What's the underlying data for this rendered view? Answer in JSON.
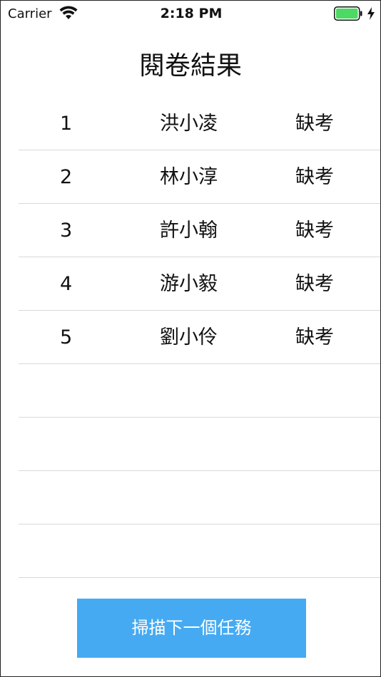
{
  "status_bar": {
    "carrier": "Carrier",
    "time": "2:18 PM",
    "battery_color": "#4cd964"
  },
  "title": "閱卷結果",
  "rows": [
    {
      "no": "1",
      "name": "洪小凌",
      "status": "缺考"
    },
    {
      "no": "2",
      "name": "林小淳",
      "status": "缺考"
    },
    {
      "no": "3",
      "name": "許小翰",
      "status": "缺考"
    },
    {
      "no": "4",
      "name": "游小毅",
      "status": "缺考"
    },
    {
      "no": "5",
      "name": "劉小伶",
      "status": "缺考"
    },
    {
      "no": "",
      "name": "",
      "status": ""
    },
    {
      "no": "",
      "name": "",
      "status": ""
    },
    {
      "no": "",
      "name": "",
      "status": ""
    },
    {
      "no": "",
      "name": "",
      "status": ""
    }
  ],
  "scan_button": {
    "label": "掃描下一個任務",
    "color": "#45aaf2"
  }
}
